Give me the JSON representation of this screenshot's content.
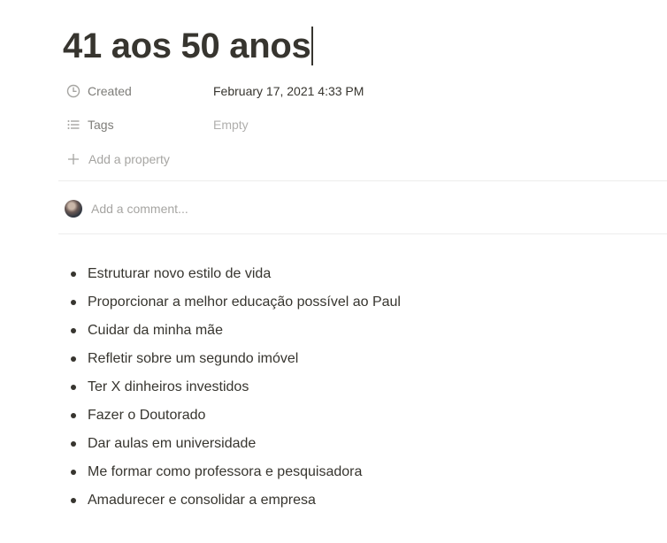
{
  "page": {
    "title": "41 aos 50 anos"
  },
  "properties": [
    {
      "icon": "clock-icon",
      "label": "Created",
      "value": "February 17, 2021 4:33 PM",
      "empty": false
    },
    {
      "icon": "list-icon",
      "label": "Tags",
      "value": "Empty",
      "empty": true
    }
  ],
  "add_property": {
    "icon": "plus-icon",
    "label": "Add a property"
  },
  "comment": {
    "placeholder": "Add a comment..."
  },
  "bullets": [
    "Estruturar novo estilo de vida",
    "Proporcionar a melhor educação possível ao Paul",
    "Cuidar da minha mãe",
    "Refletir sobre um segundo imóvel",
    "Ter X dinheiros investidos",
    "Fazer o Doutorado",
    "Dar aulas em universidade",
    "Me formar como professora e pesquisadora",
    "Amadurecer e consolidar a empresa"
  ]
}
